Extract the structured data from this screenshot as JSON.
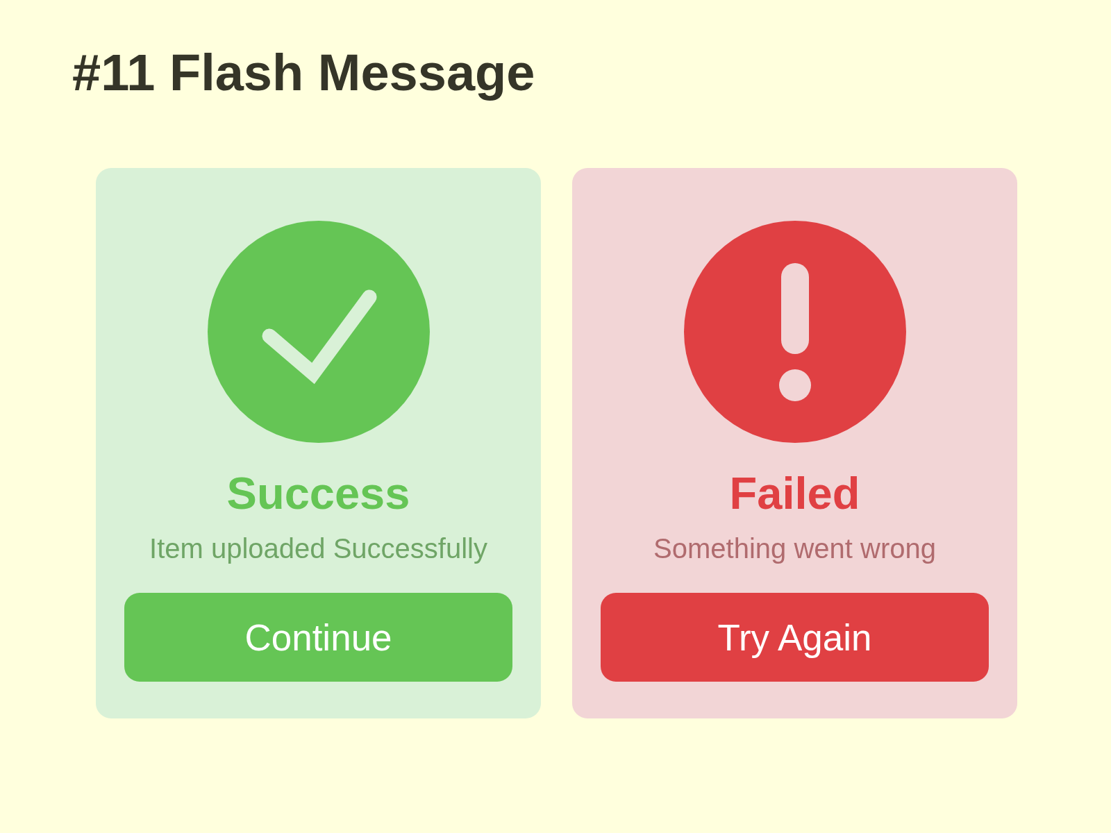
{
  "title": "#11 Flash Message",
  "messages": [
    {
      "kind": "success",
      "heading": "Success",
      "text": "Item uploaded Successfully",
      "button": "Continue"
    },
    {
      "kind": "error",
      "heading": "Failed",
      "text": "Something went wrong",
      "button": "Try Again"
    }
  ]
}
